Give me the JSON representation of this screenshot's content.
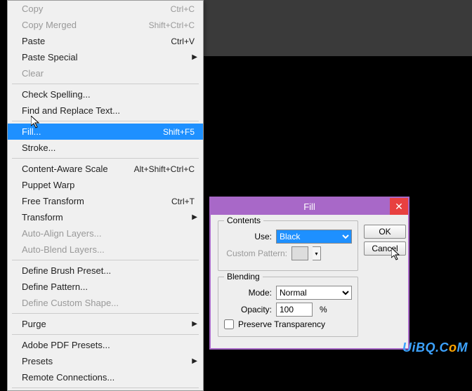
{
  "menu": {
    "copy": {
      "label": "Copy",
      "shortcut": "Ctrl+C"
    },
    "copyMerged": {
      "label": "Copy Merged",
      "shortcut": "Shift+Ctrl+C"
    },
    "paste": {
      "label": "Paste",
      "shortcut": "Ctrl+V"
    },
    "pasteSpecial": {
      "label": "Paste Special"
    },
    "clear": {
      "label": "Clear"
    },
    "checkSpelling": {
      "label": "Check Spelling..."
    },
    "findReplace": {
      "label": "Find and Replace Text..."
    },
    "fill": {
      "label": "Fill...",
      "shortcut": "Shift+F5"
    },
    "stroke": {
      "label": "Stroke..."
    },
    "contentAware": {
      "label": "Content-Aware Scale",
      "shortcut": "Alt+Shift+Ctrl+C"
    },
    "puppetWarp": {
      "label": "Puppet Warp"
    },
    "freeTransform": {
      "label": "Free Transform",
      "shortcut": "Ctrl+T"
    },
    "transform": {
      "label": "Transform"
    },
    "autoAlign": {
      "label": "Auto-Align Layers..."
    },
    "autoBlend": {
      "label": "Auto-Blend Layers..."
    },
    "defineBrush": {
      "label": "Define Brush Preset..."
    },
    "definePattern": {
      "label": "Define Pattern..."
    },
    "defineShape": {
      "label": "Define Custom Shape..."
    },
    "purge": {
      "label": "Purge"
    },
    "adobePdf": {
      "label": "Adobe PDF Presets..."
    },
    "presets": {
      "label": "Presets"
    },
    "remoteConn": {
      "label": "Remote Connections..."
    }
  },
  "dialog": {
    "title": "Fill",
    "contents": {
      "legend": "Contents",
      "use": "Use:",
      "useValue": "Black",
      "customPattern": "Custom Pattern:"
    },
    "blending": {
      "legend": "Blending",
      "mode": "Mode:",
      "modeValue": "Normal",
      "opacity": "Opacity:",
      "opacityValue": "100",
      "pct": "%",
      "preserve": "Preserve Transparency"
    },
    "ok": "OK",
    "cancel": "Cancel"
  },
  "watermark": {
    "a": "UiBQ.C",
    "b": "o",
    "c": "M"
  }
}
